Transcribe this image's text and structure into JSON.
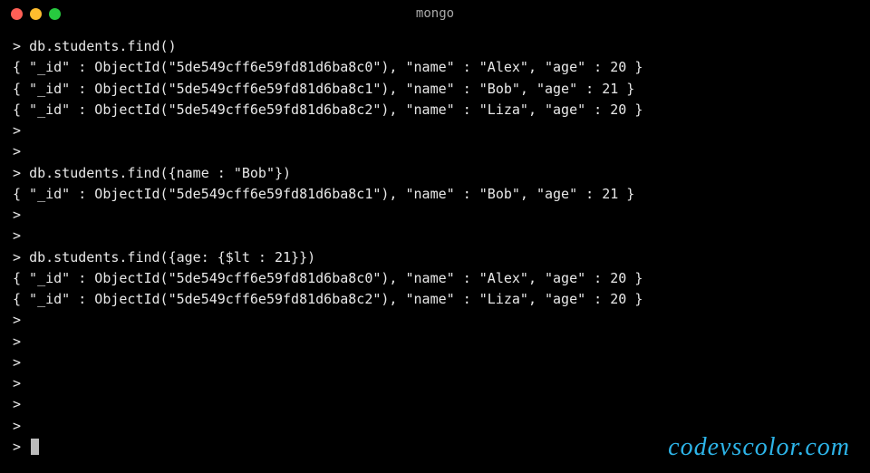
{
  "window": {
    "title": "mongo"
  },
  "traffic_lights": {
    "close_color": "#ff5f56",
    "minimize_color": "#ffbd2e",
    "zoom_color": "#27c93f"
  },
  "watermark": "codevscolor.com",
  "terminal": {
    "prompt": ">",
    "lines": [
      {
        "prompt": "> ",
        "text": "db.students.find()"
      },
      {
        "prompt": "",
        "text": "{ \"_id\" : ObjectId(\"5de549cff6e59fd81d6ba8c0\"), \"name\" : \"Alex\", \"age\" : 20 }"
      },
      {
        "prompt": "",
        "text": "{ \"_id\" : ObjectId(\"5de549cff6e59fd81d6ba8c1\"), \"name\" : \"Bob\", \"age\" : 21 }"
      },
      {
        "prompt": "",
        "text": "{ \"_id\" : ObjectId(\"5de549cff6e59fd81d6ba8c2\"), \"name\" : \"Liza\", \"age\" : 20 }"
      },
      {
        "prompt": "> ",
        "text": ""
      },
      {
        "prompt": "> ",
        "text": ""
      },
      {
        "prompt": "> ",
        "text": "db.students.find({name : \"Bob\"})"
      },
      {
        "prompt": "",
        "text": "{ \"_id\" : ObjectId(\"5de549cff6e59fd81d6ba8c1\"), \"name\" : \"Bob\", \"age\" : 21 }"
      },
      {
        "prompt": "> ",
        "text": ""
      },
      {
        "prompt": "> ",
        "text": ""
      },
      {
        "prompt": "> ",
        "text": "db.students.find({age: {$lt : 21}})"
      },
      {
        "prompt": "",
        "text": "{ \"_id\" : ObjectId(\"5de549cff6e59fd81d6ba8c0\"), \"name\" : \"Alex\", \"age\" : 20 }"
      },
      {
        "prompt": "",
        "text": "{ \"_id\" : ObjectId(\"5de549cff6e59fd81d6ba8c2\"), \"name\" : \"Liza\", \"age\" : 20 }"
      },
      {
        "prompt": "> ",
        "text": ""
      },
      {
        "prompt": "> ",
        "text": ""
      },
      {
        "prompt": "> ",
        "text": ""
      },
      {
        "prompt": "> ",
        "text": ""
      },
      {
        "prompt": "> ",
        "text": ""
      },
      {
        "prompt": "> ",
        "text": ""
      },
      {
        "prompt": "> ",
        "text": "",
        "cursor": true
      }
    ]
  }
}
